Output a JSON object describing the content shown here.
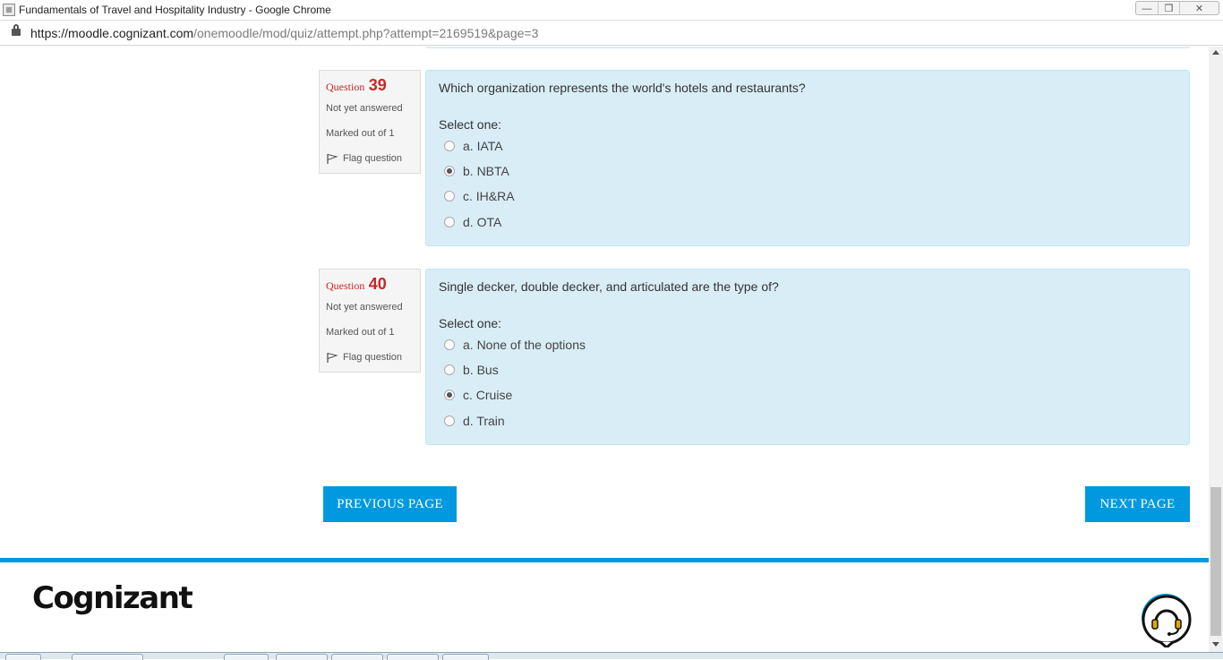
{
  "window": {
    "title": "Fundamentals of Travel and Hospitality Industry - Google Chrome",
    "controls": {
      "minimize": "—",
      "restore": "❐",
      "close": "✕"
    }
  },
  "address_bar": {
    "host": "https://moodle.cognizant.com",
    "path": "/onemoodle/mod/quiz/attempt.php?attempt=2169519&page=3"
  },
  "questions": [
    {
      "label": "Question",
      "number": "39",
      "state": "Not yet answered",
      "grade": "Marked out of 1",
      "flag": "Flag question",
      "text": "Which organization represents the world's hotels and restaurants?",
      "prompt": "Select one:",
      "answers": [
        {
          "text": "a. IATA",
          "checked": false
        },
        {
          "text": "b. NBTA",
          "checked": true
        },
        {
          "text": "c. IH&RA",
          "checked": false
        },
        {
          "text": "d. OTA",
          "checked": false
        }
      ]
    },
    {
      "label": "Question",
      "number": "40",
      "state": "Not yet answered",
      "grade": "Marked out of 1",
      "flag": "Flag question",
      "text": "Single decker, double decker, and articulated are the type of?",
      "prompt": "Select one:",
      "answers": [
        {
          "text": "a. None of the options",
          "checked": false
        },
        {
          "text": "b. Bus",
          "checked": false
        },
        {
          "text": "c. Cruise",
          "checked": true
        },
        {
          "text": "d. Train",
          "checked": false
        }
      ]
    }
  ],
  "navigation": {
    "previous": "PREVIOUS PAGE",
    "next": "NEXT PAGE"
  },
  "footer": {
    "logo": "Cognizant",
    "support_icon": "headset-support-icon"
  },
  "colors": {
    "accent": "#0099df",
    "question_number": "#c62828",
    "content_bg": "#d9edf7"
  }
}
